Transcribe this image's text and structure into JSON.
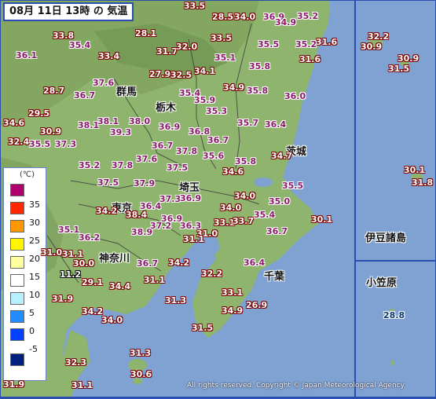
{
  "title": "08月 11日 13時 の 気温",
  "copyright": "All rights reserved. Copyright © Japan Meteorological Agency",
  "legend": {
    "unit": "(℃)",
    "levels": [
      {
        "label": "35",
        "color": "#b0006e"
      },
      {
        "label": "30",
        "color": "#ff2800"
      },
      {
        "label": "25",
        "color": "#ff9900"
      },
      {
        "label": "20",
        "color": "#fff500"
      },
      {
        "label": "15",
        "color": "#ffffa0"
      },
      {
        "label": "10",
        "color": "#ffffff"
      },
      {
        "label": "5",
        "color": "#b8f0ff"
      },
      {
        "label": "0",
        "color": "#218cff"
      },
      {
        "label": "-5",
        "color": "#0041ff"
      },
      {
        "label": "",
        "color": "#002080"
      }
    ]
  },
  "places": [
    "群馬",
    "栃木",
    "茨城",
    "埼玉",
    "東京",
    "神奈川",
    "千葉",
    "伊豆諸島",
    "小笠原"
  ],
  "temps": {
    "red": [
      "33.5",
      "28.5",
      "34.0",
      "33.8",
      "28.1",
      "31.7",
      "32.0",
      "33.5",
      "33.4",
      "34.1",
      "27.9",
      "32.5",
      "34.9",
      "28.7",
      "29.5",
      "34.6",
      "30.9",
      "32.4",
      "34.7",
      "34.6",
      "34.2",
      "38.4",
      "31.0",
      "33.1",
      "33.7",
      "34.0",
      "34.0",
      "34.2",
      "31.0",
      "32.2",
      "31.1",
      "30.1",
      "31.1",
      "29.1",
      "30.0",
      "34.4",
      "31.1",
      "31.3",
      "34.2",
      "34.0",
      "31.5",
      "33.1",
      "34.9",
      "26.9",
      "32.3",
      "31.3",
      "30.6",
      "31.1",
      "32.2",
      "30.9",
      "31.6",
      "30.9",
      "31.5",
      "30.1",
      "31.8",
      "31.6",
      "31.9",
      "31.9"
    ],
    "pink": [
      "36.9",
      "34.9",
      "35.4",
      "35.1",
      "35.5",
      "35.2",
      "35.8",
      "37.6",
      "36.7",
      "35.4",
      "35.9",
      "35.3",
      "35.8",
      "36.0",
      "38.1",
      "38.1",
      "38.0",
      "36.9",
      "36.8",
      "35.7",
      "36.4",
      "39.3",
      "37.3",
      "36.7",
      "37.8",
      "36.7",
      "35.2",
      "37.8",
      "37.6",
      "37.5",
      "35.6",
      "35.8",
      "37.5",
      "37.9",
      "37.3",
      "36.9",
      "35.5",
      "36.4",
      "35.1",
      "36.2",
      "38.9",
      "37.2",
      "36.9",
      "36.3",
      "35.0",
      "35.4",
      "36.7",
      "36.4",
      "36.7",
      "35.2",
      "36.1",
      "35.5",
      "37.6"
    ],
    "black": [
      "11.2",
      "28.8"
    ]
  }
}
